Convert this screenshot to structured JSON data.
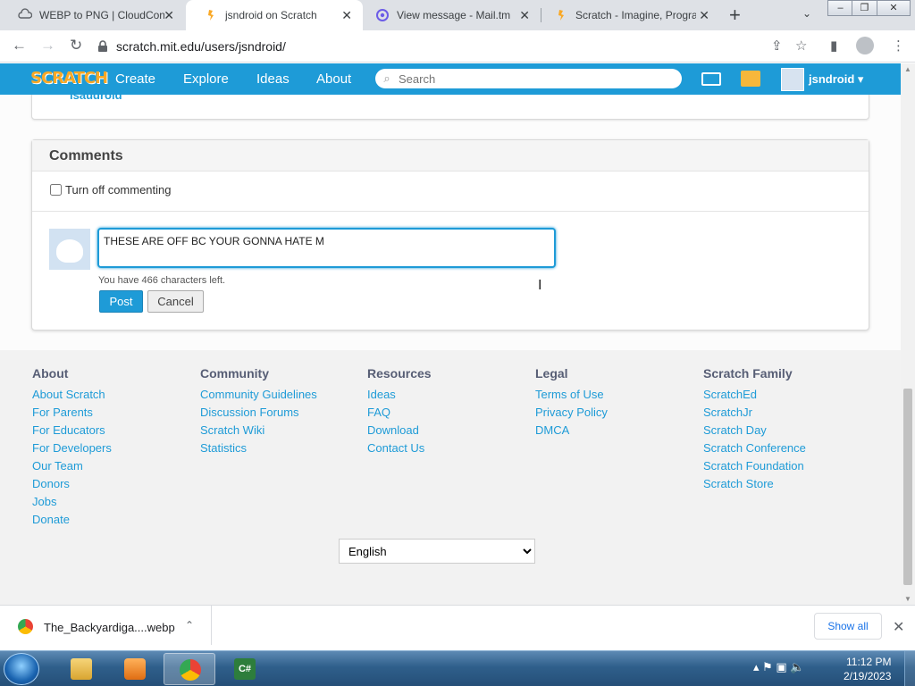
{
  "browser": {
    "tabs": [
      {
        "title": "WEBP to PNG | CloudConvert",
        "close": "✕"
      },
      {
        "title": "jsndroid on Scratch",
        "close": "✕"
      },
      {
        "title": "View message - Mail.tm",
        "close": "✕"
      },
      {
        "title": "Scratch - Imagine, Program, Share",
        "close": "✕"
      }
    ],
    "new_tab": "+",
    "tab_search": "⌄",
    "url": "scratch.mit.edu/users/jsndroid/"
  },
  "scratch_nav": {
    "logo": "SCRATCH",
    "links": [
      "Create",
      "Explore",
      "Ideas",
      "About"
    ],
    "search_placeholder": "Search",
    "username": "jsndroid",
    "dropdown": "▾"
  },
  "previous_item": {
    "name": "isaudroid"
  },
  "comments": {
    "heading": "Comments",
    "toggle_label": "Turn off commenting",
    "toggle_checked": false,
    "input_value": "THESE ARE OFF BC YOUR GONNA HATE M",
    "chars_left": "You have 466 characters left.",
    "post": "Post",
    "cancel": "Cancel"
  },
  "footer": {
    "columns": [
      {
        "heading": "About",
        "links": [
          "About Scratch",
          "For Parents",
          "For Educators",
          "For Developers",
          "Our Team",
          "Donors",
          "Jobs",
          "Donate"
        ]
      },
      {
        "heading": "Community",
        "links": [
          "Community Guidelines",
          "Discussion Forums",
          "Scratch Wiki",
          "Statistics"
        ]
      },
      {
        "heading": "Resources",
        "links": [
          "Ideas",
          "FAQ",
          "Download",
          "Contact Us"
        ]
      },
      {
        "heading": "Legal",
        "links": [
          "Terms of Use",
          "Privacy Policy",
          "DMCA"
        ]
      },
      {
        "heading": "Scratch Family",
        "links": [
          "ScratchEd",
          "ScratchJr",
          "Scratch Day",
          "Scratch Conference",
          "Scratch Foundation",
          "Scratch Store"
        ]
      }
    ],
    "language": "English"
  },
  "download_bar": {
    "filename": "The_Backyardiga....webp",
    "show_all": "Show all",
    "close": "✕"
  },
  "taskbar": {
    "time": "11:12 PM",
    "date": "2/19/2023"
  },
  "colors": {
    "scratch_blue": "#1e9bd7",
    "link_blue": "#1e9bd7",
    "footer_heading": "#575e75"
  }
}
